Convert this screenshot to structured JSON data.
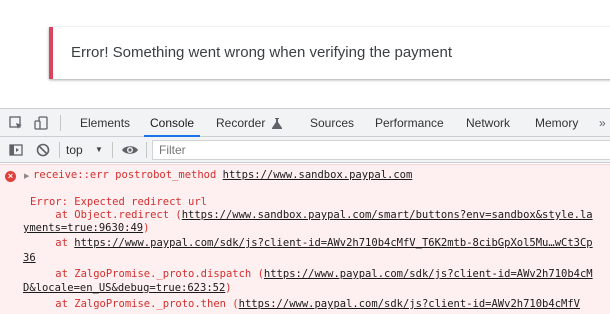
{
  "alert": {
    "message": "Error! Something went wrong when verifying the payment",
    "accent_color": "#d9455f"
  },
  "devtools": {
    "tabs": [
      {
        "label": "Elements",
        "active": false
      },
      {
        "label": "Console",
        "active": true
      },
      {
        "label": "Recorder",
        "active": false
      },
      {
        "label": "Sources",
        "active": false
      },
      {
        "label": "Performance",
        "active": false
      },
      {
        "label": "Network",
        "active": false
      },
      {
        "label": "Memory",
        "active": false
      }
    ],
    "recorder_icon": "flask-icon",
    "context": "top",
    "filter_placeholder": "Filter"
  },
  "console": {
    "message_prefix": "receive::err postrobot_method ",
    "message_url": "https://www.sandbox.paypal.com",
    "lines": [
      {
        "text": "Error: Expected redirect url",
        "indent": 1,
        "link": ""
      },
      {
        "text": "    at Object.redirect (",
        "link": "https://www.sandbox.paypal.com/smart/buttons?env=sandbox&style.la"
      },
      {
        "text": "",
        "link": "yments=true:9630:49",
        "suffix": ")"
      },
      {
        "text": "    at ",
        "link": "https://www.paypal.com/sdk/js?client-id=AWv2h710b4cMfV_T6K2mtb-8cibGpXol5Mu…wCt3Cp"
      },
      {
        "text": "",
        "link": "36"
      },
      {
        "text": "    at ZalgoPromise._proto.dispatch (",
        "link": "https://www.paypal.com/sdk/js?client-id=AWv2h710b4cM"
      },
      {
        "text": "",
        "link": "D&locale=en_US&debug=true:623:52",
        "suffix": ")"
      },
      {
        "text": "    at ZalgoPromise._proto.then (",
        "link": "https://www.paypal.com/sdk/js?client-id=AWv2h710b4cMfV"
      }
    ]
  }
}
